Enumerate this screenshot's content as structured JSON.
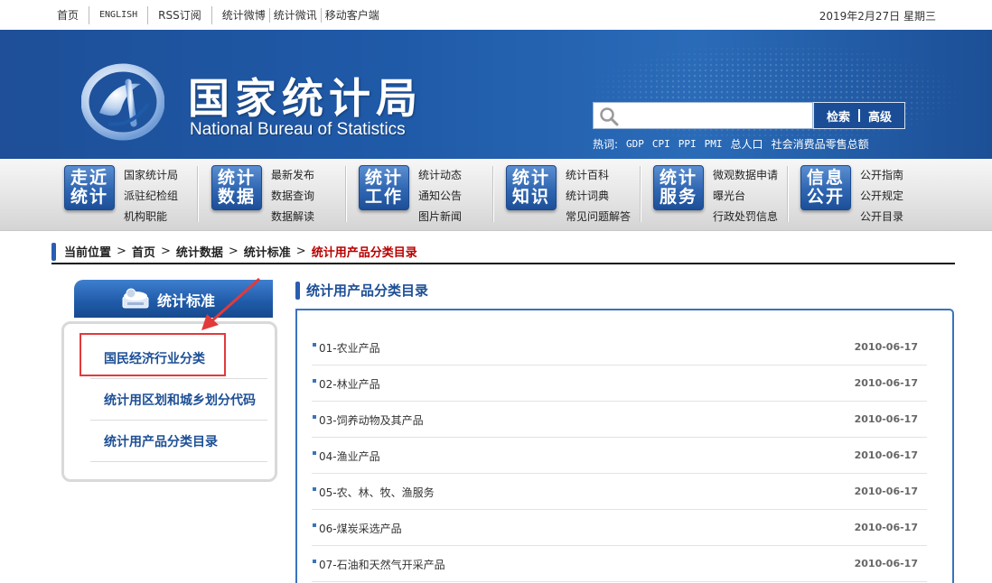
{
  "topbar": {
    "links": [
      "首页",
      "ENGLISH",
      "RSS订阅",
      "统计微博",
      "统计微讯",
      "移动客户端"
    ],
    "date": "2019年2月27日  星期三"
  },
  "banner": {
    "title_cn": "国家统计局",
    "title_en": "National Bureau of Statistics",
    "search": {
      "placeholder": "",
      "btn_search": "检索",
      "btn_advanced": "高级"
    },
    "hot_label": "热词:",
    "hot_words": [
      "GDP",
      "CPI",
      "PPI",
      "PMI",
      "总人口",
      "社会消费品零售总额"
    ]
  },
  "nav": [
    {
      "icon": [
        "走近",
        "统计"
      ],
      "links": [
        "国家统计局",
        "派驻纪检组",
        "机构职能"
      ]
    },
    {
      "icon": [
        "统计",
        "数据"
      ],
      "links": [
        "最新发布",
        "数据查询",
        "数据解读"
      ]
    },
    {
      "icon": [
        "统计",
        "工作"
      ],
      "links": [
        "统计动态",
        "通知公告",
        "图片新闻"
      ]
    },
    {
      "icon": [
        "统计",
        "知识"
      ],
      "links": [
        "统计百科",
        "统计词典",
        "常见问题解答"
      ]
    },
    {
      "icon": [
        "统计",
        "服务"
      ],
      "links": [
        "微观数据申请",
        "曝光台",
        "行政处罚信息"
      ]
    },
    {
      "icon": [
        "信息",
        "公开"
      ],
      "links": [
        "公开指南",
        "公开规定",
        "公开目录"
      ]
    }
  ],
  "breadcrumb": {
    "label": "当前位置",
    "items": [
      "首页",
      "统计数据",
      "统计标准"
    ],
    "current": "统计用产品分类目录"
  },
  "sidebar": {
    "title": "统计标准",
    "items": [
      "国民经济行业分类",
      "统计用区划和城乡划分代码",
      "统计用产品分类目录"
    ]
  },
  "main": {
    "title": "统计用产品分类目录",
    "rows": [
      {
        "name": "01-农业产品",
        "date": "2010-06-17"
      },
      {
        "name": "02-林业产品",
        "date": "2010-06-17"
      },
      {
        "name": "03-饲养动物及其产品",
        "date": "2010-06-17"
      },
      {
        "name": "04-渔业产品",
        "date": "2010-06-17"
      },
      {
        "name": "05-农、林、牧、渔服务",
        "date": "2010-06-17"
      },
      {
        "name": "06-煤炭采选产品",
        "date": "2010-06-17"
      },
      {
        "name": "07-石油和天然气开采产品",
        "date": "2010-06-17"
      }
    ]
  },
  "colors": {
    "brand_blue": "#1f5aa8",
    "highlight_red": "#e23a3a",
    "current_red": "#b80000"
  }
}
